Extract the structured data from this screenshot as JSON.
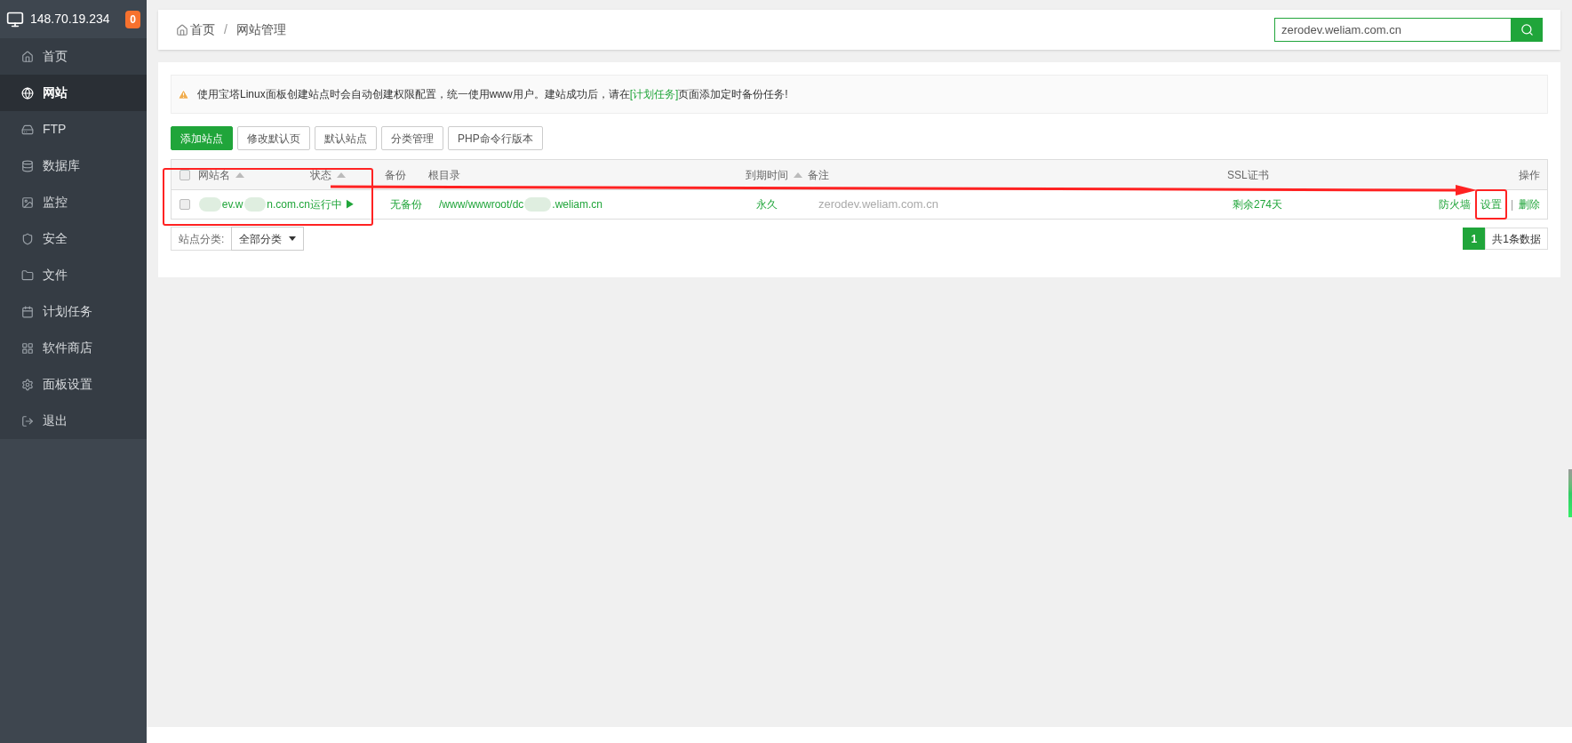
{
  "server": {
    "ip": "148.70.19.234",
    "badge": "0"
  },
  "sidebar": {
    "items": [
      {
        "label": "首页",
        "selected": false
      },
      {
        "label": "网站",
        "selected": true
      },
      {
        "label": "FTP",
        "selected": false
      },
      {
        "label": "数据库",
        "selected": false
      },
      {
        "label": "监控",
        "selected": false
      },
      {
        "label": "安全",
        "selected": false
      },
      {
        "label": "文件",
        "selected": false
      },
      {
        "label": "计划任务",
        "selected": false
      },
      {
        "label": "软件商店",
        "selected": false
      },
      {
        "label": "面板设置",
        "selected": false
      },
      {
        "label": "退出",
        "selected": false
      }
    ]
  },
  "breadcrumb": {
    "items": [
      "首页",
      "网站管理"
    ],
    "separator": "/"
  },
  "search": {
    "value": "zerodev.weliam.com.cn"
  },
  "notice": {
    "before": "使用宝塔Linux面板创建站点时会自动创建权限配置，统一使用www用户。建站成功后，请在",
    "link": "[计划任务]",
    "after": "页面添加定时备份任务!"
  },
  "toolbar": [
    {
      "label": "添加站点",
      "kind": "primary"
    },
    {
      "label": "修改默认页",
      "kind": "default"
    },
    {
      "label": "默认站点",
      "kind": "default"
    },
    {
      "label": "分类管理",
      "kind": "default"
    },
    {
      "label": "PHP命令行版本",
      "kind": "default"
    }
  ],
  "table": {
    "all_checked": false,
    "columns": [
      {
        "label": "网站名",
        "sortable": true
      },
      {
        "label": "状态",
        "sortable": true
      },
      {
        "label": "备份",
        "sortable": false
      },
      {
        "label": "根目录",
        "sortable": false
      },
      {
        "label": "到期时间",
        "sortable": true
      },
      {
        "label": "备注",
        "sortable": false
      },
      {
        "label": "SSL证书",
        "sortable": false
      },
      {
        "label": "操作",
        "sortable": false
      }
    ],
    "rows": [
      {
        "checked": false,
        "name_parts": [
          "ev.w",
          "n.com.cn"
        ],
        "status": "运行中 ▶",
        "backup": "无备份",
        "root_parts": [
          "/www/wwwroot/dc",
          ".weliam.cn"
        ],
        "expiry": "永久",
        "note": "zerodev.weliam.com.cn",
        "ssl": "剩余274天",
        "actions": [
          "防火墙",
          "设置",
          "删除"
        ],
        "action_separator": "|"
      }
    ]
  },
  "category": {
    "label": "站点分类:",
    "value": "全部分类"
  },
  "pagination": {
    "pages": [
      {
        "label": "1",
        "selected": true
      }
    ],
    "total": "共1条数据"
  }
}
